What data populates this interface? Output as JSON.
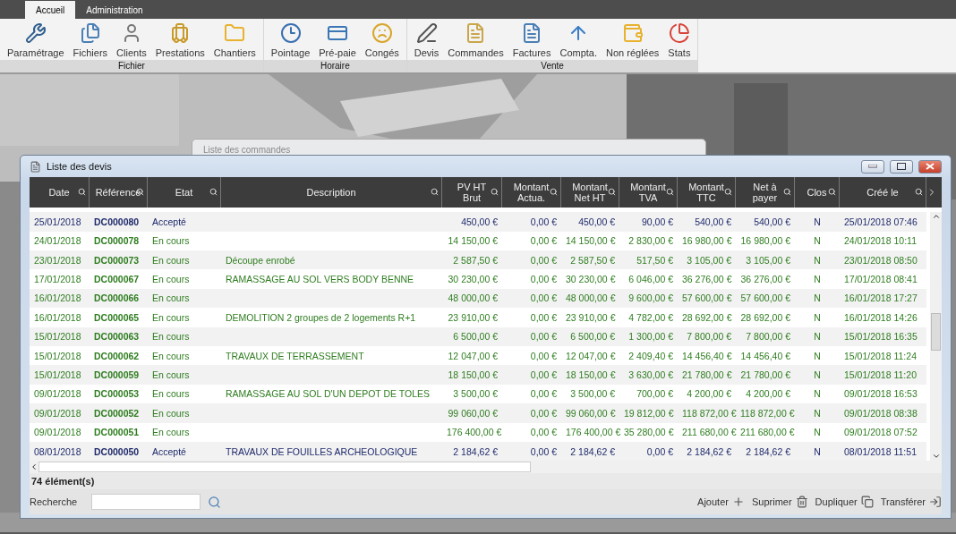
{
  "tabs": [
    {
      "label": "Accueil",
      "selected": true
    },
    {
      "label": "Administration",
      "selected": false
    }
  ],
  "ribbon": {
    "groups": [
      {
        "label": "Fichier",
        "buttons": [
          "Paramétrage",
          "Fichiers",
          "Clients",
          "Prestations",
          "Chantiers"
        ]
      },
      {
        "label": "Horaire",
        "buttons": [
          "Pointage",
          "Pré-paie",
          "Congés"
        ]
      },
      {
        "label": "Vente",
        "buttons": [
          "Devis",
          "Commandes",
          "Factures",
          "Compta.",
          "Non réglées",
          "Stats"
        ]
      }
    ]
  },
  "background_window": {
    "title": "Liste des commandes"
  },
  "window": {
    "title": "Liste des devis",
    "columns": [
      "Date",
      "Référence",
      "Etat",
      "Description",
      "PV HT Brut",
      "Montant Actua.",
      "Montant Net HT",
      "Montant TVA",
      "Montant TTC",
      "Net à payer",
      "Clos",
      "Créé le"
    ],
    "rows": [
      {
        "color": "#1f2a6b",
        "cells": [
          "25/01/2018",
          "DC000080",
          "Accepté",
          "",
          "450,00 €",
          "0,00 €",
          "450,00 €",
          "90,00 €",
          "540,00 €",
          "540,00 €",
          "N",
          "25/01/2018 07:46"
        ]
      },
      {
        "color": "#2e7d1f",
        "cells": [
          "24/01/2018",
          "DC000078",
          "En cours",
          "",
          "14 150,00 €",
          "0,00 €",
          "14 150,00 €",
          "2 830,00 €",
          "16 980,00 €",
          "16 980,00 €",
          "N",
          "24/01/2018 10:11"
        ]
      },
      {
        "color": "#2e7d1f",
        "cells": [
          "23/01/2018",
          "DC000073",
          "En cours",
          "Découpe enrobé",
          "2 587,50 €",
          "0,00 €",
          "2 587,50 €",
          "517,50 €",
          "3 105,00 €",
          "3 105,00 €",
          "N",
          "23/01/2018 08:50"
        ]
      },
      {
        "color": "#2e7d1f",
        "cells": [
          "17/01/2018",
          "DC000067",
          "En cours",
          "RAMASSAGE AU SOL VERS BODY BENNE",
          "30 230,00 €",
          "0,00 €",
          "30 230,00 €",
          "6 046,00 €",
          "36 276,00 €",
          "36 276,00 €",
          "N",
          "17/01/2018 08:41"
        ]
      },
      {
        "color": "#2e7d1f",
        "cells": [
          "16/01/2018",
          "DC000066",
          "En cours",
          "",
          "48 000,00 €",
          "0,00 €",
          "48 000,00 €",
          "9 600,00 €",
          "57 600,00 €",
          "57 600,00 €",
          "N",
          "16/01/2018 17:27"
        ]
      },
      {
        "color": "#2e7d1f",
        "cells": [
          "16/01/2018",
          "DC000065",
          "En cours",
          "DEMOLITION 2 groupes de 2 logements R+1",
          "23 910,00 €",
          "0,00 €",
          "23 910,00 €",
          "4 782,00 €",
          "28 692,00 €",
          "28 692,00 €",
          "N",
          "16/01/2018 14:26"
        ]
      },
      {
        "color": "#2e7d1f",
        "cells": [
          "15/01/2018",
          "DC000063",
          "En cours",
          "",
          "6 500,00 €",
          "0,00 €",
          "6 500,00 €",
          "1 300,00 €",
          "7 800,00 €",
          "7 800,00 €",
          "N",
          "15/01/2018 16:35"
        ]
      },
      {
        "color": "#2e7d1f",
        "cells": [
          "15/01/2018",
          "DC000062",
          "En cours",
          "TRAVAUX DE TERRASSEMENT",
          "12 047,00 €",
          "0,00 €",
          "12 047,00 €",
          "2 409,40 €",
          "14 456,40 €",
          "14 456,40 €",
          "N",
          "15/01/2018 11:24"
        ]
      },
      {
        "color": "#2e7d1f",
        "cells": [
          "15/01/2018",
          "DC000059",
          "En cours",
          "",
          "18 150,00 €",
          "0,00 €",
          "18 150,00 €",
          "3 630,00 €",
          "21 780,00 €",
          "21 780,00 €",
          "N",
          "15/01/2018 11:20"
        ]
      },
      {
        "color": "#2e7d1f",
        "cells": [
          "09/01/2018",
          "DC000053",
          "En cours",
          "RAMASSAGE AU SOL D'UN DEPOT DE TOLES",
          "3 500,00 €",
          "0,00 €",
          "3 500,00 €",
          "700,00 €",
          "4 200,00 €",
          "4 200,00 €",
          "N",
          "09/01/2018 16:53"
        ]
      },
      {
        "color": "#2e7d1f",
        "cells": [
          "09/01/2018",
          "DC000052",
          "En cours",
          "",
          "99 060,00 €",
          "0,00 €",
          "99 060,00 €",
          "19 812,00 €",
          "118 872,00 €",
          "118 872,00 €",
          "N",
          "09/01/2018 08:38"
        ]
      },
      {
        "color": "#2e7d1f",
        "cells": [
          "09/01/2018",
          "DC000051",
          "En cours",
          "",
          "176 400,00 €",
          "0,00 €",
          "176 400,00 €",
          "35 280,00 €",
          "211 680,00 €",
          "211 680,00 €",
          "N",
          "09/01/2018 07:52"
        ]
      },
      {
        "color": "#1f2a6b",
        "cells": [
          "08/01/2018",
          "DC000050",
          "Accepté",
          "TRAVAUX DE FOUILLES ARCHEOLOGIQUE",
          "2 184,62 €",
          "0,00 €",
          "2 184,62 €",
          "0,00 €",
          "2 184,62 €",
          "2 184,62 €",
          "N",
          "08/01/2018 11:51"
        ]
      }
    ],
    "count": "74 élément(s)",
    "search_label": "Recherche",
    "actions": [
      "Ajouter",
      "Suprimer",
      "Dupliquer",
      "Transférer"
    ]
  }
}
